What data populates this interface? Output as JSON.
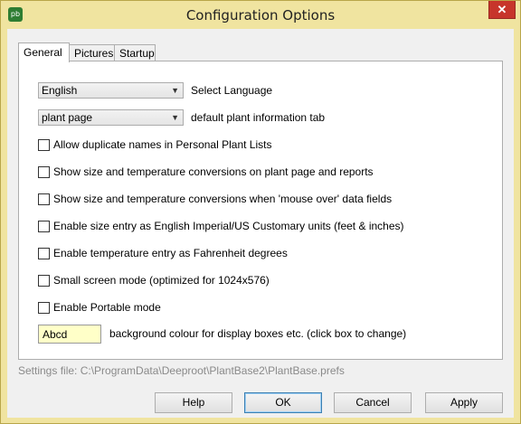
{
  "window": {
    "title": "Configuration Options",
    "icon_text": "pb",
    "close_label": "✕"
  },
  "tabs": [
    {
      "label": "General"
    },
    {
      "label": "Pictures"
    },
    {
      "label": "Startup"
    }
  ],
  "general": {
    "language_select": {
      "value": "English",
      "label": "Select Language"
    },
    "plant_tab_select": {
      "value": "plant page",
      "label": "default plant information tab"
    },
    "options": [
      {
        "label": "Allow duplicate names in Personal Plant Lists",
        "checked": false
      },
      {
        "label": "Show size and temperature conversions on plant page and reports",
        "checked": false
      },
      {
        "label": "Show size and temperature conversions when 'mouse over' data fields",
        "checked": false
      },
      {
        "label": "Enable size entry as English Imperial/US Customary units (feet & inches)",
        "checked": false
      },
      {
        "label": "Enable temperature entry as Fahrenheit degrees",
        "checked": false
      },
      {
        "label": "Small screen mode (optimized for 1024x576)",
        "checked": false
      },
      {
        "label": "Enable Portable mode",
        "checked": false
      }
    ],
    "color_box": {
      "value": "Abcd",
      "label": "background colour for display boxes etc. (click box to change)",
      "color": "#ffffc8"
    }
  },
  "settings_file": "Settings file: C:\\ProgramData\\Deeproot\\PlantBase2\\PlantBase.prefs",
  "buttons": {
    "help": "Help",
    "ok": "OK",
    "cancel": "Cancel",
    "apply": "Apply"
  },
  "colors": {
    "frame": "#f0e4a0",
    "close": "#c7352b",
    "accent": "#3c7fb1"
  }
}
